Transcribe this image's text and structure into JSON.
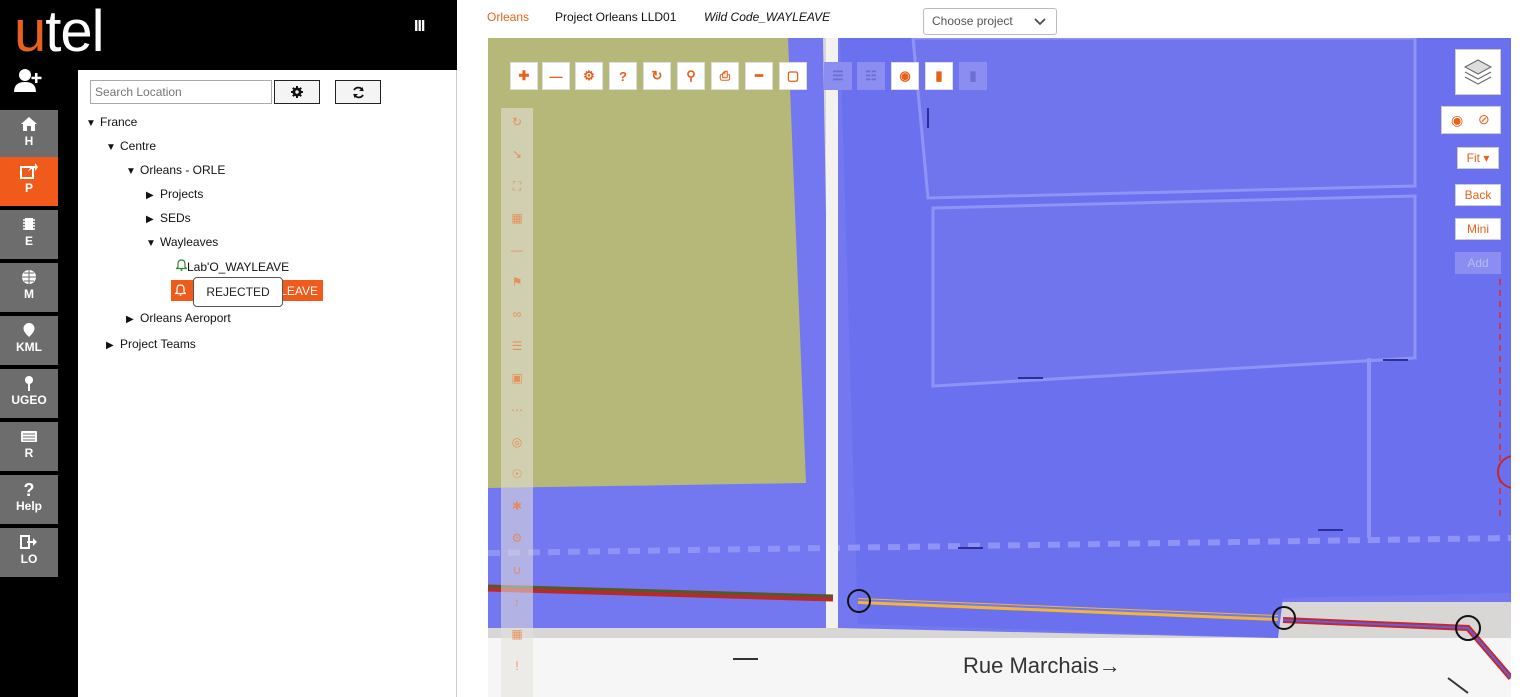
{
  "logo": {
    "first": "u",
    "rest": "tel"
  },
  "nav": [
    {
      "label": "H",
      "icon": "home-icon"
    },
    {
      "label": "P",
      "icon": "share-icon"
    },
    {
      "label": "E",
      "icon": "chip-icon"
    },
    {
      "label": "M",
      "icon": "globe-icon"
    },
    {
      "label": "KML",
      "icon": "map-marker-icon"
    },
    {
      "label": "UGEO",
      "icon": "pin-icon"
    },
    {
      "label": "R",
      "icon": "list-icon"
    },
    {
      "label": "Help",
      "icon": "question-icon"
    },
    {
      "label": "LO",
      "icon": "logout-icon"
    }
  ],
  "search": {
    "placeholder": "Search Location"
  },
  "tree": {
    "france": "France",
    "centre": "Centre",
    "orleans": "Orleans - ORLE",
    "projects": "Projects",
    "seds": "SEDs",
    "wayleaves": "Wayleaves",
    "lab_wayleave": "Lab'O_WAYLEAVE",
    "selected_suffix": "LEAVE",
    "aeroport": "Orleans Aeroport",
    "project_teams": "Project Teams"
  },
  "tooltip": "REJECTED",
  "breadcrumb": {
    "location": "Orleans",
    "project": "Project Orleans LLD01",
    "wild_code": "Wild Code_WAYLEAVE"
  },
  "project_select": "Choose project",
  "map": {
    "street": "Rue Marchais→",
    "buttons": {
      "fit": "Fit ▾",
      "back": "Back",
      "mini": "Mini",
      "add": "Add"
    }
  },
  "colors": {
    "accent": "#f05a1a",
    "nav_bg": "#6d6d6d",
    "map_blue": "#7378f0",
    "map_olive": "#b5b878"
  }
}
